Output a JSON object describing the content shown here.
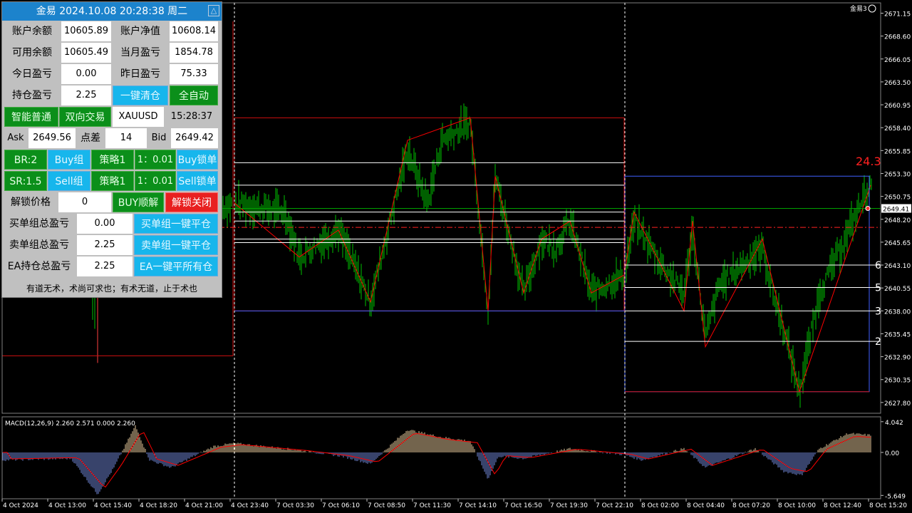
{
  "panel": {
    "title": "金易 2024.10.08 20:28:38 周二",
    "collapse_icon": "triangle-up-icon",
    "rows": {
      "balance_label": "账户余额",
      "balance_value": "10605.89",
      "equity_label": "账户净值",
      "equity_value": "10608.14",
      "free_label": "可用余额",
      "free_value": "10605.49",
      "month_pl_label": "当月盈亏",
      "month_pl_value": "1854.78",
      "today_pl_label": "今日盈亏",
      "today_pl_value": "0.00",
      "yesterday_pl_label": "昨日盈亏",
      "yesterday_pl_value": "75.33",
      "position_pl_label": "持仓盈亏",
      "position_pl_value": "2.25",
      "close_all_label": "一键清仓",
      "auto_label": "全自动",
      "smart_label": "智能普通",
      "twoway_label": "双向交易",
      "symbol": "XAUUSD",
      "time": "15:28:37",
      "ask_label": "Ask",
      "ask_value": "2649.56",
      "spread_label": "点差",
      "spread_value": "14",
      "bid_label": "Bid",
      "bid_value": "2649.42",
      "br_label": "BR:2",
      "buy_group_label": "Buy组",
      "strategy1_label": "策略1",
      "ratio1_label": "1：0.01",
      "buy_lock_label": "Buy锁单",
      "sr_label": "SR:1.5",
      "sell_group_label": "Sell组",
      "strategy2_label": "策略1",
      "ratio2_label": "1：0.01",
      "sell_lock_label": "Sell锁单",
      "unlock_price_label": "解锁价格",
      "unlock_price_value": "0",
      "buy_unlock_label": "BUY顺解",
      "unlock_close_label": "解锁关闭",
      "buy_total_label": "买单组总盈亏",
      "buy_total_value": "0.00",
      "buy_close_label": "买单组一键平仓",
      "sell_total_label": "卖单组总盈亏",
      "sell_total_value": "2.25",
      "sell_close_label": "卖单组一键平仓",
      "ea_total_label": "EA持仓总盈亏",
      "ea_total_value": "2.25",
      "ea_close_label": "EA一键平所有仓"
    },
    "motto": "有道无术，术尚可求也；有术无道，止于术也"
  },
  "chart": {
    "top_right_label": "金易3",
    "smile_icon": "smiley-icon",
    "price_ticks": [
      "2671.15",
      "2668.60",
      "2666.05",
      "2663.50",
      "2660.95",
      "2658.40",
      "2655.85",
      "2653.30",
      "2650.75",
      "2648.20",
      "2645.65",
      "2643.10",
      "2640.55",
      "2638.00",
      "2635.45",
      "2632.90",
      "2630.35",
      "2627.80"
    ],
    "current_price": "2649.41",
    "box_label": "24.3",
    "right_level_labels": [
      "6",
      "5",
      "3",
      "2"
    ],
    "macd_label": "MACD(12,26,9) 2.260 2.571 0.000 2.260",
    "macd_ticks": [
      "4.042",
      "0.00",
      "-5.649"
    ],
    "time_labels": [
      "4 Oct 2024",
      "4 Oct 13:00",
      "4 Oct 15:40",
      "4 Oct 18:20",
      "4 Oct 21:00",
      "4 Oct 23:40",
      "7 Oct 03:30",
      "7 Oct 06:10",
      "7 Oct 08:50",
      "7 Oct 11:30",
      "7 Oct 14:10",
      "7 Oct 16:50",
      "7 Oct 19:30",
      "7 Oct 22:10",
      "8 Oct 02:00",
      "8 Oct 04:40",
      "8 Oct 07:20",
      "8 Oct 10:00",
      "8 Oct 12:40",
      "8 Oct 15:20"
    ],
    "colors": {
      "bar": "#00c000",
      "zigzag": "#ff0000",
      "macd_hist_up": "#e6c79a",
      "macd_hist_dn": "#6f86d6",
      "signal": "#ff0000",
      "grid_v": "#ffffff"
    }
  }
}
